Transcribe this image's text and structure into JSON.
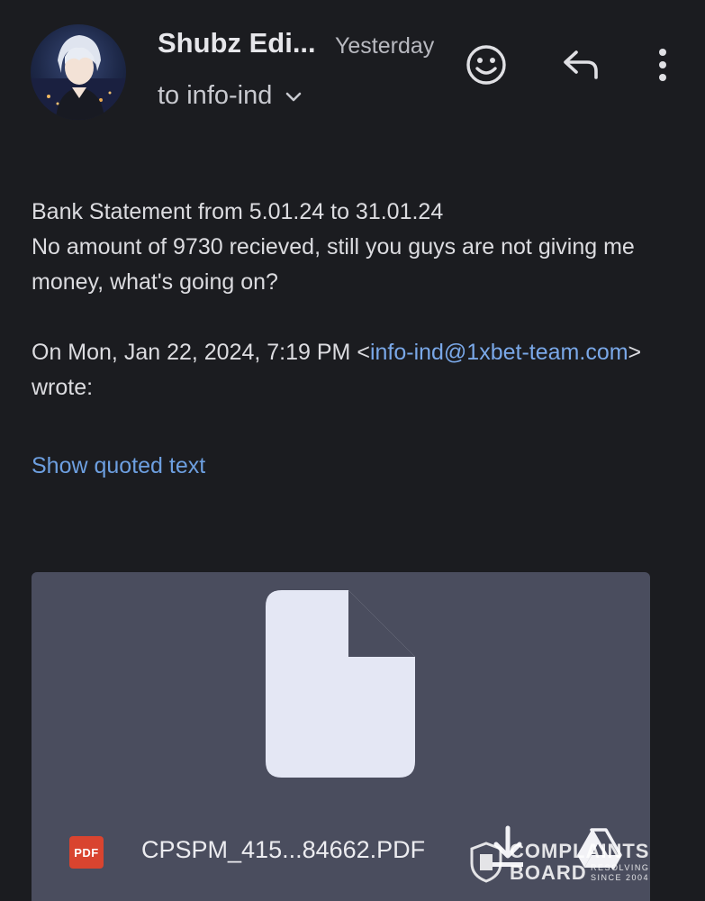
{
  "header": {
    "sender_name": "Shubz Edi...",
    "timestamp": "Yesterday",
    "recipient": "to info-ind",
    "avatar_icon": "avatar-anime-character"
  },
  "actions": {
    "emoji_icon": "smiley-icon",
    "reply_icon": "reply-icon",
    "more_icon": "more-vertical-icon"
  },
  "message": {
    "line1": "Bank Statement from 5.01.24 to 31.01.24",
    "line2": "No amount of 9730 recieved, still you guys are not giving me money, what's going on?",
    "quote_prefix": "On Mon, Jan 22, 2024, 7:19 PM <",
    "quote_email": "info-ind@1xbet-team.com",
    "quote_suffix": ">",
    "quote_wrote": "wrote:",
    "show_quoted": "Show quoted text"
  },
  "attachment": {
    "type_badge": "PDF",
    "file_name": "CPSPM_415...84662.PDF",
    "card_color": "#4a4d5e",
    "preview_icon": "document-icon",
    "download_icon": "download-icon",
    "drive_icon": "google-drive-icon"
  },
  "watermark": {
    "line1": "COMPLAINTS",
    "line2": "BOARD",
    "tag1": "RESOLVING",
    "tag2": "SINCE 2004"
  },
  "colors": {
    "background": "#1b1c20",
    "link": "#7aa8e8",
    "pdf_red": "#d9442f"
  }
}
